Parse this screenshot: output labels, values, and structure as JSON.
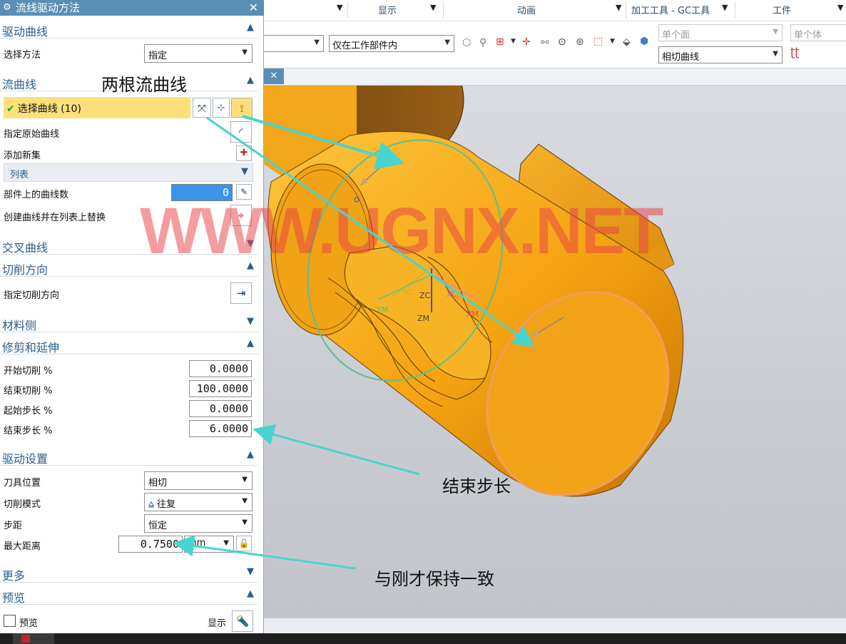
{
  "ribbon": {
    "tabs": [
      "显示",
      "动画",
      "加工工具 - GC工具",
      "工件"
    ]
  },
  "toolbar": {
    "filter_value": "",
    "scope_value": "仅在工作部件内",
    "face_rule": "单个面",
    "body_rule": "单个体",
    "curve_rule": "相切曲线"
  },
  "dialog": {
    "title": "流线驱动方法",
    "sections": {
      "drive_curve": "驱动曲线",
      "flow_curve": "流曲线",
      "cross_curve": "交叉曲线",
      "cut_direction": "切削方向",
      "material_side": "材料侧",
      "trim_extend": "修剪和延伸",
      "drive_settings": "驱动设置",
      "more": "更多",
      "preview": "预览"
    },
    "select_method_label": "选择方法",
    "select_method_value": "指定",
    "select_curve": "选择曲线 (10)",
    "specify_origin_curve": "指定原始曲线",
    "add_new_set": "添加新集",
    "list_label": "列表",
    "curves_on_part_label": "部件上的曲线数",
    "curves_on_part_value": "0",
    "create_replace_label": "创建曲线并在列表上替换",
    "specify_cut_direction": "指定切削方向",
    "trim": {
      "start_cut_label": "开始切削 %",
      "start_cut_value": "0.0000",
      "end_cut_label": "结束切削 %",
      "end_cut_value": "100.0000",
      "start_step_label": "起始步长 %",
      "start_step_value": "0.0000",
      "end_step_label": "结束步长 %",
      "end_step_value": "6.0000"
    },
    "drive": {
      "tool_position_label": "刀具位置",
      "tool_position_value": "相切",
      "cut_mode_label": "切削模式",
      "cut_mode_value": "往复",
      "stepover_label": "步距",
      "stepover_value": "恒定",
      "max_distance_label": "最大距离",
      "max_distance_value": "0.7500",
      "max_distance_unit": "mm"
    },
    "preview_label": "预览",
    "display_label": "显示"
  },
  "annotations": {
    "two_flow_curves": "两根流曲线",
    "end_step": "结束步长",
    "keep_same": "与刚才保持一致"
  },
  "watermark": "WWW.UGNX.NET",
  "axis_labels": {
    "yc": "YC",
    "zc": "ZC",
    "xc": "XC",
    "ym": "YM",
    "zm": "ZM",
    "xm": "XM"
  },
  "colors": {
    "title_bar": "#5a8fb5",
    "section_text": "#2a5d8c",
    "selected_row": "#fde07a",
    "part_orange": "#f7a516",
    "arrow_cyan": "#48d4d0",
    "watermark_red": "#e84448"
  }
}
